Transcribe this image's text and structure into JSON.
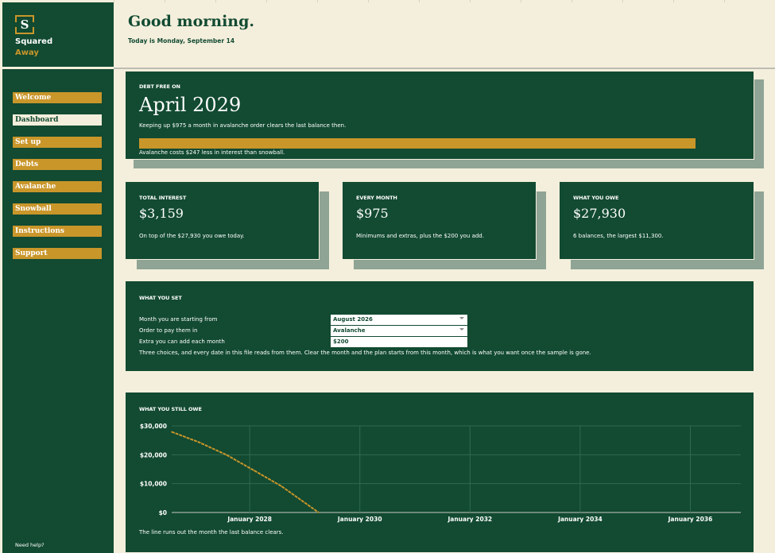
{
  "brand": {
    "mark": "S",
    "line1": "Squared",
    "line2": "Away"
  },
  "nav": [
    {
      "label": "Welcome",
      "active": false
    },
    {
      "label": "Dashboard",
      "active": true
    },
    {
      "label": "Set up",
      "active": false
    },
    {
      "label": "Debts",
      "active": false
    },
    {
      "label": "Avalanche",
      "active": false
    },
    {
      "label": "Snowball",
      "active": false
    },
    {
      "label": "Instructions",
      "active": false
    },
    {
      "label": "Support",
      "active": false
    }
  ],
  "help_text": "Need help?",
  "header": {
    "greeting": "Good morning.",
    "today": "Today is Monday, September 14"
  },
  "debt_free": {
    "kicker": "DEBT FREE ON",
    "date": "April 2029",
    "subtitle": "Keeping up $975 a month in avalanche order clears the last balance then.",
    "progress_fraction": 1.0,
    "note": "Avalanche costs $247 less in interest than snowball."
  },
  "stats": [
    {
      "kicker": "TOTAL INTEREST",
      "value": "$3,159",
      "note": "On top of the $27,930 you owe today."
    },
    {
      "kicker": "EVERY MONTH",
      "value": "$975",
      "note": "Minimums and extras, plus the $200 you add."
    },
    {
      "kicker": "WHAT YOU OWE",
      "value": "$27,930",
      "note": "6 balances, the largest $11,300."
    }
  ],
  "settings": {
    "kicker": "WHAT YOU SET",
    "rows": [
      {
        "label": "Month you are starting from",
        "value": "August 2026",
        "dropdown": true
      },
      {
        "label": "Order to pay them in",
        "value": "Avalanche",
        "dropdown": true
      },
      {
        "label": "Extra you can add each month",
        "value": "$200",
        "dropdown": false
      }
    ],
    "note": "Three choices, and every date in this file reads from them. Clear the month and the plan starts from this month, which is what you want once the sample is gone."
  },
  "chart_section": {
    "kicker": "WHAT YOU STILL OWE",
    "note": "The line runs out the month the last balance clears."
  },
  "colors": {
    "green": "#124a32",
    "gold": "#c9962a",
    "cream": "#f4efdc",
    "shadow": "#8fa495"
  },
  "chart_data": {
    "type": "line",
    "x_ticks": [
      "January 2028",
      "January 2030",
      "January 2032",
      "January 2034",
      "January 2036"
    ],
    "y_ticks": [
      "$0",
      "$10,000",
      "$20,000",
      "$30,000"
    ],
    "ylim": [
      0,
      30000
    ],
    "xlim": [
      "2026-08",
      "2036-12"
    ],
    "grid": true,
    "series": [
      {
        "color": "#c9962a",
        "points": [
          {
            "x": "2026-08",
            "y": 27930
          },
          {
            "x": "2027-02",
            "y": 24300
          },
          {
            "x": "2027-08",
            "y": 19900
          },
          {
            "x": "2028-02",
            "y": 14500
          },
          {
            "x": "2028-08",
            "y": 9000
          },
          {
            "x": "2029-04",
            "y": 0
          }
        ]
      }
    ]
  }
}
